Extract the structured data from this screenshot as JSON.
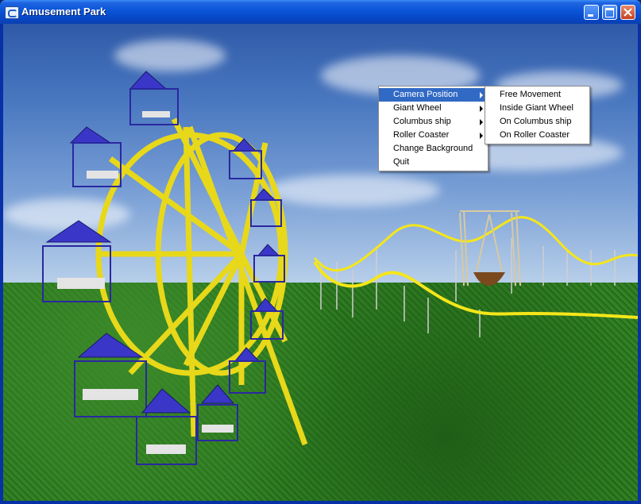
{
  "window": {
    "title": "Amusement Park",
    "title_bar_color": "#0a55d8"
  },
  "context_menu": {
    "items": [
      {
        "label": "Camera Position",
        "has_submenu": true,
        "active": true
      },
      {
        "label": "Giant Wheel",
        "has_submenu": true
      },
      {
        "label": "Columbus ship",
        "has_submenu": true
      },
      {
        "label": "Roller Coaster",
        "has_submenu": true
      },
      {
        "label": "Change Background",
        "has_submenu": false
      },
      {
        "label": "Quit",
        "has_submenu": false
      }
    ]
  },
  "submenu": {
    "parent": "Camera Position",
    "items": [
      {
        "label": "Free Movement"
      },
      {
        "label": "Inside Giant Wheel"
      },
      {
        "label": "On Columbus ship"
      },
      {
        "label": "On Roller Coaster"
      }
    ]
  },
  "colors": {
    "highlight": "#316ac5",
    "wheel_yellow": "#e0d000",
    "cabin_blue": "#3a36c8"
  }
}
